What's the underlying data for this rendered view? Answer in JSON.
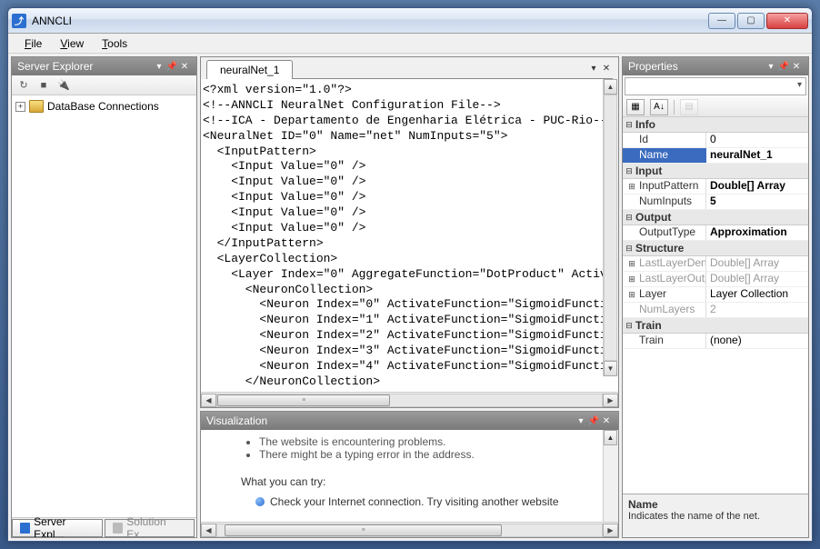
{
  "window": {
    "title": "ANNCLI"
  },
  "menu": {
    "file": "File",
    "view": "View",
    "tools": "Tools"
  },
  "serverExplorer": {
    "title": "Server Explorer",
    "node": "DataBase Connections"
  },
  "bottomTabs": {
    "server": "Server Expl...",
    "solution": "Solution Ex..."
  },
  "editor": {
    "tab": "neuralNet_1",
    "code": "<?xml version=\"1.0\"?>\n<!--ANNCLI NeuralNet Configuration File-->\n<!--ICA - Departamento de Engenharia Elétrica - PUC-Rio--\n<NeuralNet ID=\"0\" Name=\"net\" NumInputs=\"5\">\n  <InputPattern>\n    <Input Value=\"0\" />\n    <Input Value=\"0\" />\n    <Input Value=\"0\" />\n    <Input Value=\"0\" />\n    <Input Value=\"0\" />\n  </InputPattern>\n  <LayerCollection>\n    <Layer Index=\"0\" AggregateFunction=\"DotProduct\" Activa\n      <NeuronCollection>\n        <Neuron Index=\"0\" ActivateFunction=\"SigmoidFunctio\n        <Neuron Index=\"1\" ActivateFunction=\"SigmoidFunctio\n        <Neuron Index=\"2\" ActivateFunction=\"SigmoidFunctio\n        <Neuron Index=\"3\" ActivateFunction=\"SigmoidFunctio\n        <Neuron Index=\"4\" ActivateFunction=\"SigmoidFunctio\n      </NeuronCollection>"
  },
  "visualization": {
    "title": "Visualization",
    "bullet1": "The website is encountering problems.",
    "bullet2": "There might be a typing error in the address.",
    "try": "What you can try:",
    "check": "Check your Internet connection. Try visiting another website"
  },
  "properties": {
    "title": "Properties",
    "categories": {
      "info": "Info",
      "input": "Input",
      "output": "Output",
      "structure": "Structure",
      "train": "Train"
    },
    "rows": {
      "id_k": "Id",
      "id_v": "0",
      "name_k": "Name",
      "name_v": "neuralNet_1",
      "inputpattern_k": "InputPattern",
      "inputpattern_v": "Double[] Array",
      "numinputs_k": "NumInputs",
      "numinputs_v": "5",
      "outputtype_k": "OutputType",
      "outputtype_v": "Approximation",
      "lastlayerdend_k": "LastLayerDend",
      "lastlayerdend_v": "Double[] Array",
      "lastlayerout_k": "LastLayerOutp",
      "lastlayerout_v": "Double[] Array",
      "layer_k": "Layer",
      "layer_v": "Layer Collection",
      "numlayers_k": "NumLayers",
      "numlayers_v": "2",
      "train_k": "Train",
      "train_v": "(none)"
    },
    "desc_name": "Name",
    "desc_text": "Indicates the name of the net."
  }
}
